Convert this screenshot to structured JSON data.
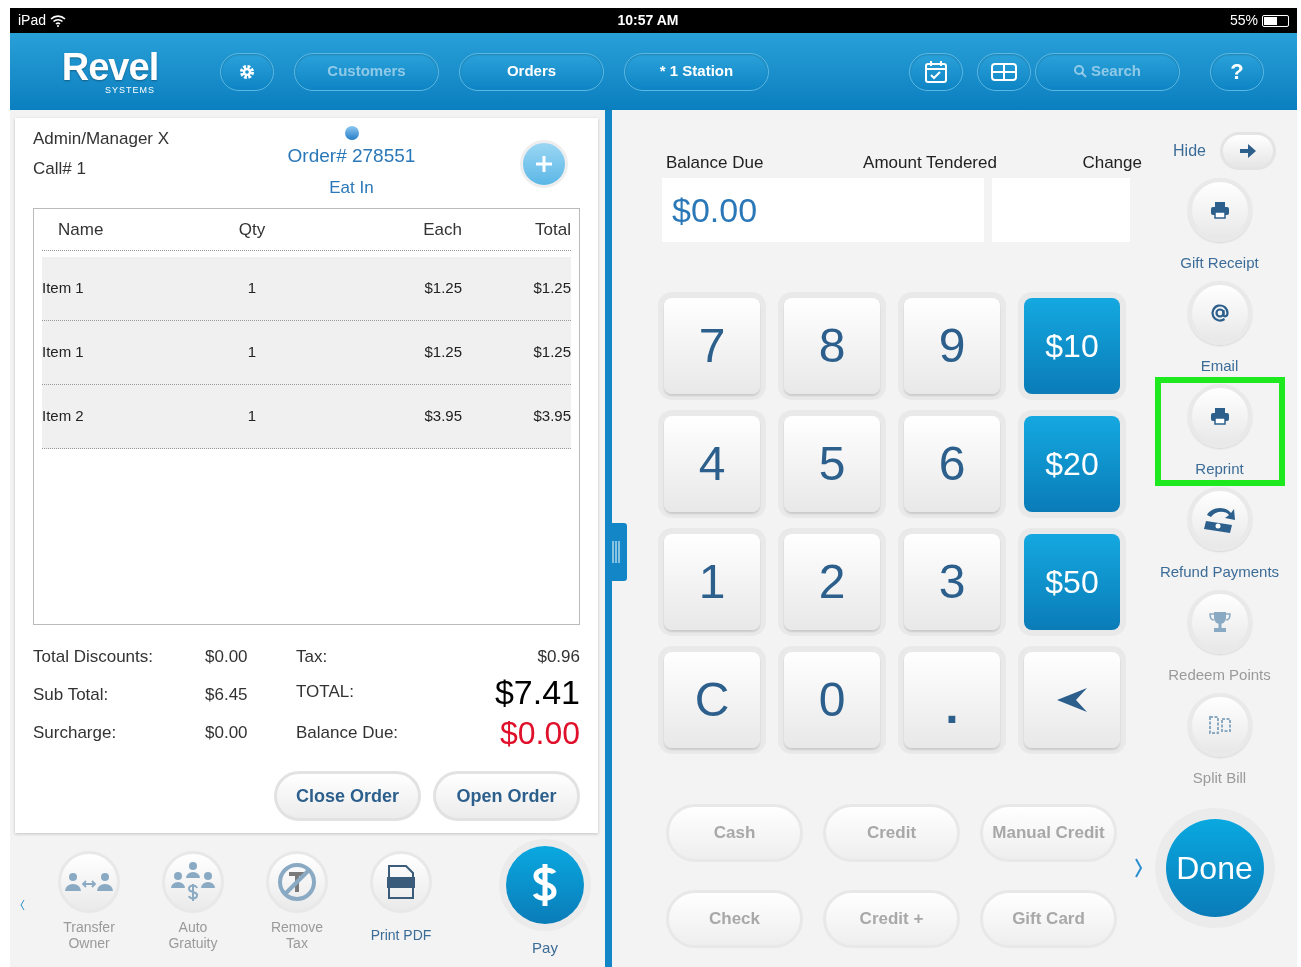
{
  "status_bar": {
    "device": "iPad",
    "time": "10:57 AM",
    "battery": "55%"
  },
  "nav": {
    "logo": "Revel",
    "logo_sub": "SYSTEMS",
    "items": [
      {
        "kind": "settings",
        "disabled": false
      },
      {
        "kind": "text",
        "label": "Customers",
        "disabled": true
      },
      {
        "kind": "text",
        "label": "Orders",
        "disabled": false
      },
      {
        "kind": "text",
        "label": "* 1 Station",
        "disabled": false
      },
      {
        "kind": "calendar",
        "disabled": false
      },
      {
        "kind": "tables",
        "disabled": false
      },
      {
        "kind": "search",
        "label": "Search",
        "disabled": true
      },
      {
        "kind": "help",
        "label": "?",
        "disabled": false
      }
    ]
  },
  "order": {
    "user": "Admin/Manager X",
    "call": "Call# 1",
    "order_number": "Order# 278551",
    "order_type": "Eat In",
    "columns": [
      "Name",
      "Qty",
      "Each",
      "Total"
    ],
    "rows": [
      {
        "name": "Item 1",
        "qty": "1",
        "each": "$1.25",
        "total": "$1.25"
      },
      {
        "name": "Item 1",
        "qty": "1",
        "each": "$1.25",
        "total": "$1.25"
      },
      {
        "name": "Item 2",
        "qty": "1",
        "each": "$3.95",
        "total": "$3.95"
      }
    ],
    "totals_left": [
      {
        "label": "Total Discounts:",
        "value": "$0.00"
      },
      {
        "label": "Sub Total:",
        "value": "$6.45"
      },
      {
        "label": "Surcharge:",
        "value": "$0.00"
      }
    ],
    "totals_right": [
      {
        "label": "Tax:",
        "value": "$0.96",
        "kind": "small"
      },
      {
        "label": "TOTAL:",
        "value": "$7.41",
        "kind": "total"
      },
      {
        "label": "Balance Due:",
        "value": "$0.00",
        "kind": "due"
      }
    ],
    "buttons": [
      "Close Order",
      "Open Order"
    ]
  },
  "toolbar": [
    {
      "kind": "transfer",
      "label": "Transfer Owner",
      "disabled": true
    },
    {
      "kind": "gratuity",
      "label": "Auto Gratuity",
      "disabled": true
    },
    {
      "kind": "tax",
      "label": "Remove Tax",
      "disabled": true
    },
    {
      "kind": "pdf",
      "label": "Print PDF",
      "disabled": false
    },
    {
      "kind": "pay",
      "label": "Pay",
      "disabled": false
    }
  ],
  "payment": {
    "headers": [
      "Balance Due",
      "Amount Tendered",
      "Change"
    ],
    "balance_due": "$0.00",
    "keys": [
      {
        "kind": "digit",
        "label": "7"
      },
      {
        "kind": "digit",
        "label": "8"
      },
      {
        "kind": "digit",
        "label": "9"
      },
      {
        "kind": "cash",
        "label": "$10"
      },
      {
        "kind": "digit",
        "label": "4"
      },
      {
        "kind": "digit",
        "label": "5"
      },
      {
        "kind": "digit",
        "label": "6"
      },
      {
        "kind": "cash",
        "label": "$20"
      },
      {
        "kind": "digit",
        "label": "1"
      },
      {
        "kind": "digit",
        "label": "2"
      },
      {
        "kind": "digit",
        "label": "3"
      },
      {
        "kind": "cash",
        "label": "$50"
      },
      {
        "kind": "digit",
        "label": "C"
      },
      {
        "kind": "digit",
        "label": "0"
      },
      {
        "kind": "dot",
        "label": "."
      },
      {
        "kind": "backspace"
      }
    ],
    "methods": [
      "Cash",
      "Credit",
      "Manual Credit",
      "Check",
      "Credit +",
      "Gift Card"
    ],
    "done": "Done"
  },
  "side": {
    "hide": "Hide",
    "actions": [
      {
        "kind": "printer",
        "label": "Gift Receipt",
        "disabled": false,
        "highlighted": false
      },
      {
        "kind": "email",
        "label": "Email",
        "disabled": false,
        "highlighted": false
      },
      {
        "kind": "printer",
        "label": "Reprint",
        "disabled": false,
        "highlighted": true
      },
      {
        "kind": "refund",
        "label": "Refund Payments",
        "disabled": false,
        "highlighted": false
      },
      {
        "kind": "trophy",
        "label": "Redeem Points",
        "disabled": true,
        "highlighted": false
      },
      {
        "kind": "split",
        "label": "Split Bill",
        "disabled": true,
        "highlighted": false
      }
    ]
  }
}
